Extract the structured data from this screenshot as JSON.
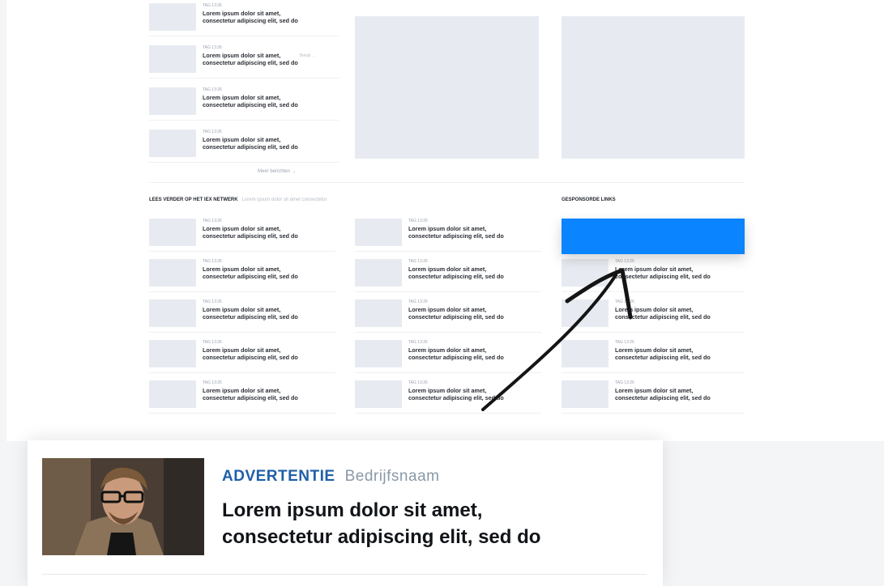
{
  "item": {
    "meta": "TAG  13:26",
    "title_line1": "Lorem ipsum dolor sit amet,",
    "title_line2": "consectetur adipiscing elit, sed do"
  },
  "top_list": {
    "side_link": "Bekijk →",
    "more_link": "Meer berichten →"
  },
  "network": {
    "heading": "LEES VERDER OP HET IEX NETWERK",
    "subheading": "Lorem ipsum dolor sit amet consectetur"
  },
  "sponsored": {
    "heading": "GESPONSORDE LINKS",
    "item_title_line1": "Lorem ipsum dolor sit amet,",
    "item_title_line2": "consectetur adipiscing elit, sed do"
  },
  "zoom": {
    "ad_label": "ADVERTENTIE",
    "company": "Bedrijfsnaam",
    "title_line1": "Lorem ipsum dolor sit amet,",
    "title_line2": "consectetur adipiscing elit, sed do"
  },
  "colors": {
    "accent_blue": "#0a84ff",
    "ad_label_blue": "#1f5fa8",
    "placeholder": "#e7ebf1"
  }
}
